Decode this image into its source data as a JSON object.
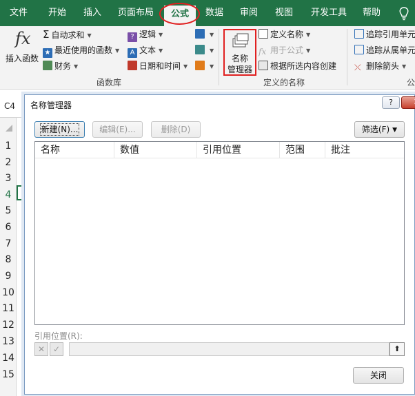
{
  "tabs": [
    "文件",
    "开始",
    "插入",
    "页面布局",
    "公式",
    "数据",
    "审阅",
    "视图",
    "开发工具",
    "帮助"
  ],
  "active_tab": "公式",
  "ribbon": {
    "insert_function": "插入函数",
    "function_library": {
      "autosum": "自动求和",
      "recent": "最近使用的函数",
      "financial": "财务",
      "logical": "逻辑",
      "text": "文本",
      "datetime": "日期和时间",
      "label": "函数库"
    },
    "defined_names": {
      "name_manager_line1": "名称",
      "name_manager_line2": "管理器",
      "define_name": "定义名称",
      "use_in_formula": "用于公式",
      "create_from_selection": "根据所选内容创建",
      "label": "定义的名称"
    },
    "auditing": {
      "trace_precedents": "追踪引用单元",
      "trace_dependents": "追踪从属单元",
      "remove_arrows": "删除箭头",
      "label_partial": "公"
    }
  },
  "formula_bar": {
    "cell_ref": "C4"
  },
  "rows": [
    "1",
    "2",
    "3",
    "4",
    "5",
    "6",
    "7",
    "8",
    "9",
    "10",
    "11",
    "12",
    "13",
    "14",
    "15"
  ],
  "selected_row": "4",
  "dialog": {
    "title": "名称管理器",
    "help": "?",
    "close": "✕",
    "new_btn": "新建(N)...",
    "edit_btn": "编辑(E)...",
    "delete_btn": "删除(D)",
    "filter_btn": "筛选(F)",
    "columns": [
      "名称",
      "数值",
      "引用位置",
      "范围",
      "批注"
    ],
    "refers_to_label": "引用位置(R):",
    "close_btn": "关闭"
  },
  "colors": {
    "excel_green": "#217346",
    "highlight_red": "#e02020"
  }
}
